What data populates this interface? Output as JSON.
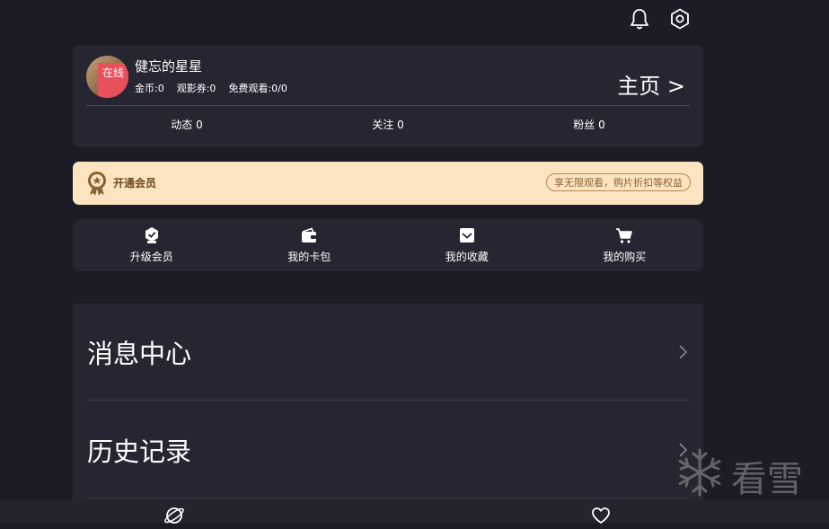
{
  "colors": {
    "background": "#1b1c26",
    "card": "#252631",
    "vip_background": "#fde4c1",
    "vip_text": "#6b4a22",
    "online_badge": "#e8505b"
  },
  "header": {
    "icons": [
      "bell-icon",
      "settings-icon"
    ]
  },
  "profile": {
    "username": "健忘的星星",
    "online_badge": "在线",
    "coins": "金币:0",
    "tickets": "观影券:0",
    "free_views": "免费观看:0/0",
    "home_link": "主页 >",
    "counts": {
      "dynamics": "动态 0",
      "following": "关注 0",
      "fans": "粉丝 0"
    }
  },
  "vip": {
    "title": "开通会员",
    "tagline": "享无限观看，购片折扣等权益",
    "icon": "medal-icon"
  },
  "quick_menu": [
    {
      "label": "升级会员",
      "icon": "upgrade-icon"
    },
    {
      "label": "我的卡包",
      "icon": "wallet-icon"
    },
    {
      "label": "我的收藏",
      "icon": "favorites-icon"
    },
    {
      "label": "我的购买",
      "icon": "cart-icon"
    }
  ],
  "list": [
    {
      "label": "消息中心"
    },
    {
      "label": "历史记录"
    }
  ],
  "bottom_nav": {
    "icons": [
      "planet-icon",
      "heart-icon"
    ]
  },
  "watermark": {
    "text": "看雪",
    "icon": "snowflake-icon"
  }
}
